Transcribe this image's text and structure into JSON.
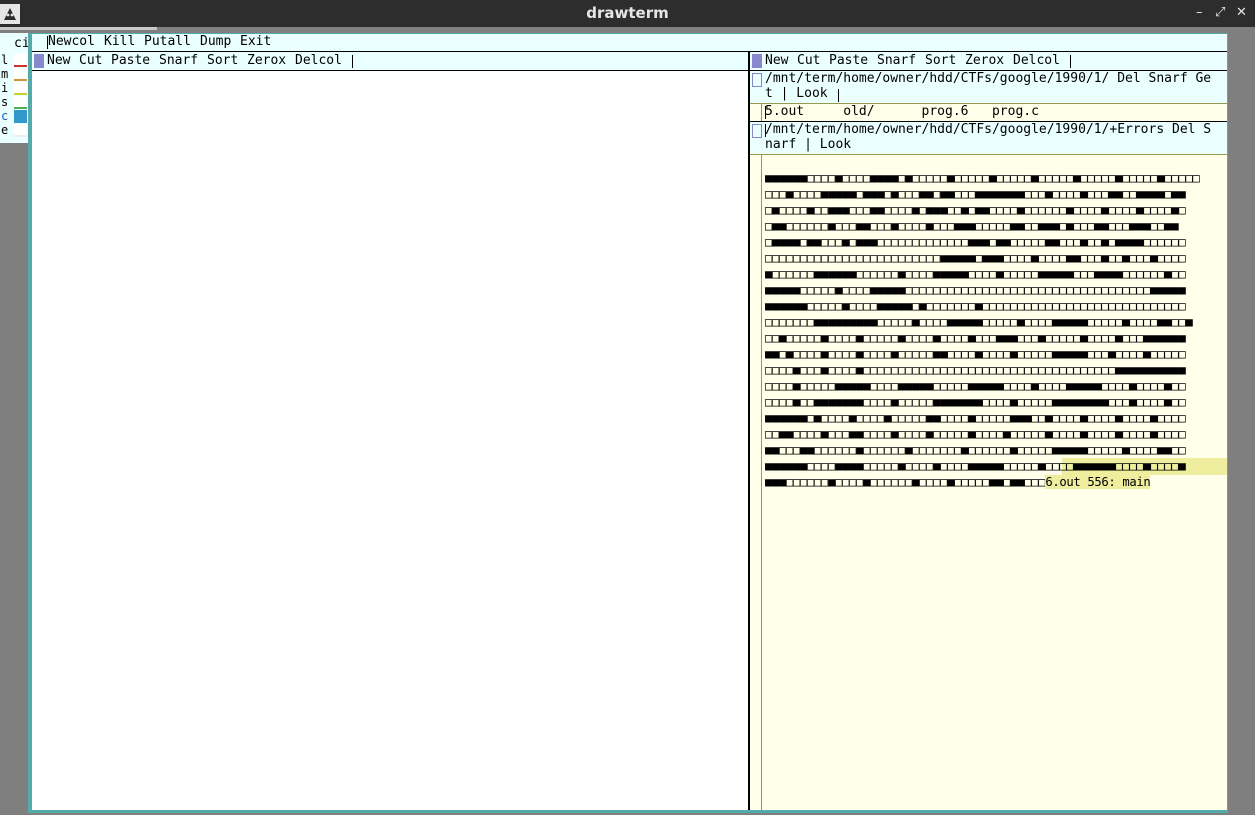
{
  "window": {
    "title": "drawterm",
    "minimize": "–",
    "maximize": "⤢",
    "close": "✕"
  },
  "bg_window": {
    "tag": "ci",
    "rows": [
      {
        "letter": "l",
        "color": "#cc3333"
      },
      {
        "letter": "m",
        "color": "#cc9933"
      },
      {
        "letter": "i",
        "color": "#cccc33"
      },
      {
        "letter": "s",
        "color": "#55aa55"
      },
      {
        "letter": "c",
        "color": "#3399cc"
      },
      {
        "letter": "e",
        "color": "#eeeeee"
      }
    ]
  },
  "rowtag": {
    "commands": [
      "Newcol",
      "Kill",
      "Putall",
      "Dump",
      "Exit"
    ]
  },
  "col1": {
    "tag": [
      "New",
      "Cut",
      "Paste",
      "Snarf",
      "Sort",
      "Zerox",
      "Delcol"
    ]
  },
  "col2": {
    "tag": [
      "New",
      "Cut",
      "Paste",
      "Snarf",
      "Sort",
      "Zerox",
      "Delcol"
    ],
    "dir_window": {
      "tag_line1": "/mnt/term/home/owner/hdd/CTFs/google/1990/1/ Del Snarf Ge",
      "tag_line2": "t | Look",
      "body": "5.out     old/      prog.6   prog.c"
    },
    "err_window": {
      "tag_line1": "/mnt/term/home/owner/hdd/CTFs/google/1990/1/+Errors Del S",
      "tag_line2": "narf | Look",
      "lines": [
        "■■■■■■□□□□■□□□□■■■■□■□□□□□■□□□□□■□□□□□■□□□□□■□□□□□■□□□□□■□□□□□",
        "□□□■□□□□■■■■■□■■■□■□□□■■□■■□□□■■■■■■■□□□■□□□□■□□□■■□□■■■■□■■",
        "□■□□□□■□□■■■□□□■■□□□□■□■■■□□■□■■□□□□■□□□□□□■□□□□■□□□□■□□□□■□",
        "□■■□□□□□□■□□□■■□□□■□□□□■□□□■■■□□□□□■■□□■■■□■□□□■■□□□■■■□□■■",
        "□■■■■□■■□□□■□■■■□□□□□□□□□□□□□■■■□■■□□□□□■■□□□■□□■□■■■■□□□□□□",
        "□□□□□□□□□□□□□□□□□□□□□□□□□■■■■■□■■■□□□□■□□□□■■□□□■□□■□□□■□□□□",
        "■□□□□□□■■■■■■□□□□□□■□□□□■■■■■□□□□■□□□□□■■■■■□□□■■■■□□□□□□■□□",
        "■■■■■□□□□□■□□□□■■■■■□□□□□□□□□□□□□□□□□□□□□□□□□□□□□□□□□□□■■■■■",
        "■■■■■■□□□□□■□□□□■■■■■□■□□□□□□□■□□□□□□□□□□□□□□□□□□□□□□□□□□□□□",
        "□□□□□□□■■■■■■■■■□□□□□■□□□□■■■■■□□□□□■□□□□■■■■■□□□□□■□□□□■■□□■",
        "□□■□□□□□■□□□□■□□□□□■□□□□■□□□□■□□□■■■□□□■□□□□□■□□□□■□□□■■■■■■",
        "■■□■□□□□■□□□□■□□□□■□□□□□■■□□□□■□□□□■□□□□□■■■■■□□□■□□□□■□□□□□",
        "□□□□■□□□■□□□□■□□□□□□□□□□□□□□□□□□□□□□□□□□□□□□□□□□□□■■■■■■■■■■",
        "□□□□■□□□□□■■■■■□□□□■■■■■□□□□□■■■■■□□□□■□□□□■■■■■□□□□■□□□□■□□",
        "□□□□■□□■■■■■■■□□□□■□□□□□■■■■■■■□□□□■□□□□□■■■■■■■■□□□■□□□□■□□",
        "■■■■■■□■□□□□■□□□□■□□□□□■■□□□□■□□□□□■■■□□■□□□□■□□□□■□□□□■□□□□",
        "□□■■□□□□■□□□■■□□□□■□□□□■□□□□□■□□□□■□□□□□■□□□□■□□□□■□□□□■□□□□",
        "■■□□□■■□□□□□□■□□□□□□■□□□□□□□■□□□□□□■□□□□□■■■■■□□□□□■□□□□■■□□",
        "■■■■■■□□□□■■■■□□□□□■□□□□■□□□□■■■■■□□□□□■□□□□■■■■■■□□□□■□□□□■"
      ],
      "last_line_blocks": "■■■□□□□□□■□□□□■□□□□□□■□□□□■□□□□□■■□■■□□□",
      "last_line_text": "6.out 556: main"
    }
  },
  "colors": {
    "tag_bg": "#eaffff",
    "body_bg": "#ffffea",
    "border": "#55aaaa",
    "selection": "#eeee9e"
  }
}
